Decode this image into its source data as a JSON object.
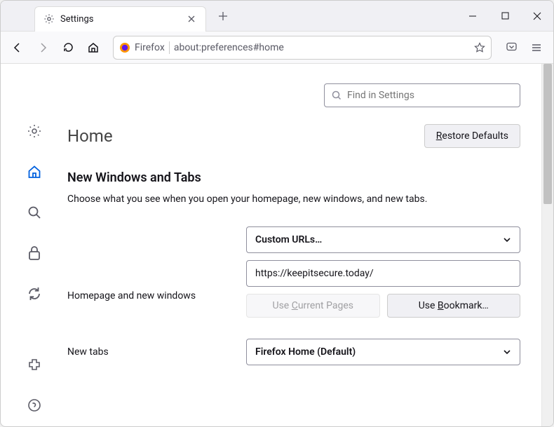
{
  "tab": {
    "title": "Settings"
  },
  "url": {
    "identity": "Firefox",
    "text": "about:preferences#home"
  },
  "search": {
    "placeholder": "Find in Settings"
  },
  "page": {
    "title": "Home"
  },
  "buttons": {
    "restore_defaults": "Restore Defaults",
    "use_current": "Use Current Pages",
    "use_bookmark": "Use Bookmark…"
  },
  "section": {
    "title": "New Windows and Tabs",
    "desc": "Choose what you see when you open your homepage, new windows, and new tabs."
  },
  "form": {
    "homepage_label": "Homepage and new windows",
    "homepage_select": "Custom URLs…",
    "homepage_value": "https://keepitsecure.today/",
    "newtabs_label": "New tabs",
    "newtabs_select": "Firefox Home (Default)"
  }
}
